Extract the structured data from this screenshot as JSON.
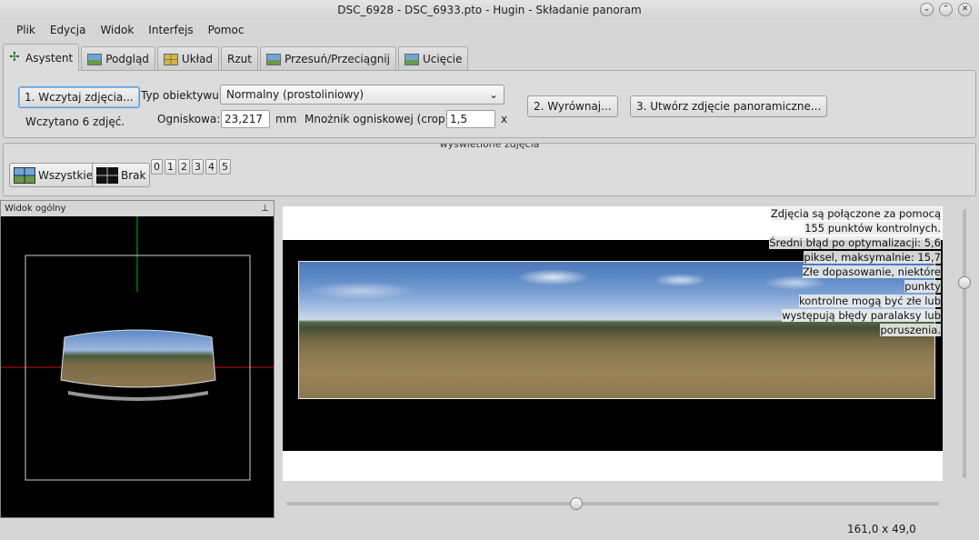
{
  "window": {
    "title": "DSC_6928 - DSC_6933.pto - Hugin - Składanie panoram",
    "controls": [
      "⌄",
      "⌃",
      "✕"
    ]
  },
  "menu": [
    "Plik",
    "Edycja",
    "Widok",
    "Interfejs",
    "Pomoc"
  ],
  "tabs": [
    {
      "label": "Asystent",
      "icon": "wand-icon",
      "active": true
    },
    {
      "label": "Podgląd",
      "icon": "preview-icon"
    },
    {
      "label": "Układ",
      "icon": "layout-icon"
    },
    {
      "label": "Rzut",
      "icon": ""
    },
    {
      "label": "Przesuń/Przeciągnij",
      "icon": "move-drag-icon"
    },
    {
      "label": "Ucięcie",
      "icon": "crop-icon"
    }
  ],
  "assistant": {
    "load_button": "1. Wczytaj zdjęcia...",
    "loaded_status": "Wczytano 6 zdjęć.",
    "lens_type_label": "Typ obiektywu:",
    "lens_type_value": "Normalny (prostoliniowy)",
    "focal_label": "Ogniskowa:",
    "focal_value": "23,217",
    "focal_unit": "mm",
    "crop_label": "Mnożnik ogniskowej (crop):",
    "crop_value": "1,5",
    "crop_unit": "x",
    "align_button": "2. Wyrównaj...",
    "create_button": "3. Utwórz zdjęcie panoramiczne..."
  },
  "visible_images": {
    "title": "wyświetlone zdjęcia",
    "all_button": "Wszystkie",
    "none_button": "Brak",
    "numbers": [
      "0",
      "1",
      "2",
      "3",
      "4",
      "5"
    ]
  },
  "overview": {
    "title": "Widok ogólny"
  },
  "preview": {
    "status_lines": [
      "Zdjęcia są połączone za pomocą",
      "155 punktów kontrolnych.",
      "Średni błąd po optymalizacji: 5,6",
      "piksel, maksymalnie: 15,7",
      "Złe dopasowanie, niektóre punkty",
      "kontrolne mogą być złe lub",
      "występują błędy paralaksy lub",
      "poruszenia."
    ]
  },
  "statusbar": {
    "coords": "161,0 x 49,0"
  }
}
